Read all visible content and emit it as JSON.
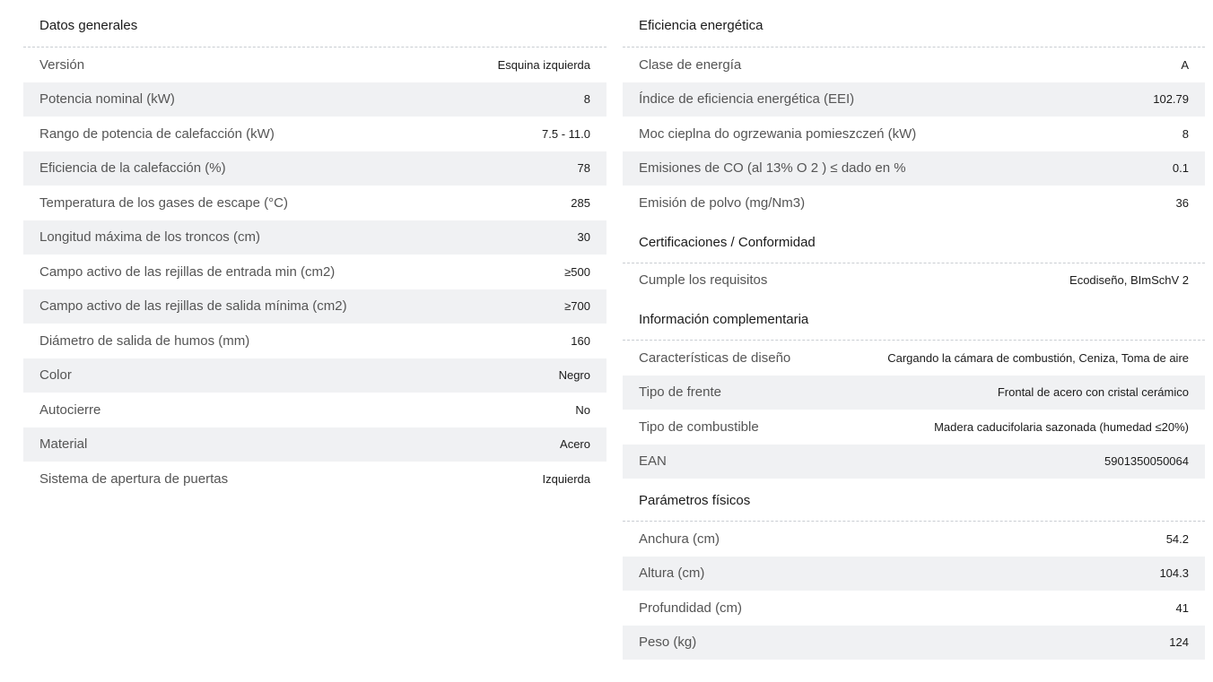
{
  "left": {
    "title": "Datos generales",
    "rows": [
      {
        "label": "Versión",
        "value": "Esquina izquierda"
      },
      {
        "label": "Potencia nominal (kW)",
        "value": "8"
      },
      {
        "label": "Rango de potencia de calefacción (kW)",
        "value": "7.5 - 11.0"
      },
      {
        "label": "Eficiencia de la calefacción (%)",
        "value": "78"
      },
      {
        "label": "Temperatura de los gases de escape (°C)",
        "value": "285"
      },
      {
        "label": "Longitud máxima de los troncos (cm)",
        "value": "30"
      },
      {
        "label": "Campo activo de las rejillas de entrada min (cm2)",
        "value": "≥500"
      },
      {
        "label": "Campo activo de las rejillas de salida mínima (cm2)",
        "value": "≥700"
      },
      {
        "label": "Diámetro de salida de humos (mm)",
        "value": "160"
      },
      {
        "label": "Color",
        "value": "Negro"
      },
      {
        "label": "Autocierre",
        "value": "No"
      },
      {
        "label": "Material",
        "value": "Acero"
      },
      {
        "label": "Sistema de apertura de puertas",
        "value": "Izquierda"
      }
    ]
  },
  "right": {
    "efficiency": {
      "title": "Eficiencia energética",
      "rows": [
        {
          "label": "Clase de energía",
          "value": "A"
        },
        {
          "label": "Índice de eficiencia energética (EEI)",
          "value": "102.79"
        },
        {
          "label": "Moc cieplna do ogrzewania pomieszczeń (kW)",
          "value": "8"
        },
        {
          "label": "Emisiones de CO (al 13% O 2 ) ≤ dado en %",
          "value": "0.1"
        },
        {
          "label": "Emisión de polvo (mg/Nm3)",
          "value": "36"
        }
      ]
    },
    "certifications": {
      "title": "Certificaciones / Conformidad",
      "rows": [
        {
          "label": "Cumple los requisitos",
          "value": "Ecodiseño, BImSchV 2"
        }
      ]
    },
    "complementary": {
      "title": "Información complementaria",
      "rows": [
        {
          "label": "Características de diseño",
          "value": "Cargando la cámara de combustión, Ceniza, Toma de aire"
        },
        {
          "label": "Tipo de frente",
          "value": "Frontal de acero con cristal cerámico"
        },
        {
          "label": "Tipo de combustible",
          "value": "Madera caducifolaria sazonada (humedad ≤20%)"
        },
        {
          "label": "EAN",
          "value": "5901350050064"
        }
      ]
    },
    "physical": {
      "title": "Parámetros físicos",
      "rows": [
        {
          "label": "Anchura (cm)",
          "value": "54.2"
        },
        {
          "label": "Altura (cm)",
          "value": "104.3"
        },
        {
          "label": "Profundidad (cm)",
          "value": "41"
        },
        {
          "label": "Peso (kg)",
          "value": "124"
        }
      ]
    }
  }
}
